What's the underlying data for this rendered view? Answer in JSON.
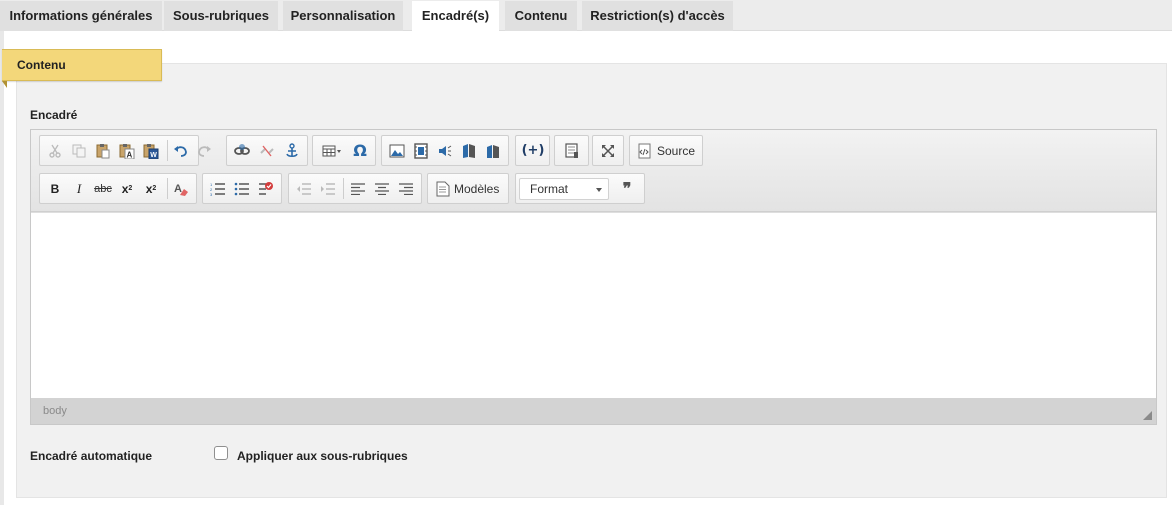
{
  "tabs": [
    {
      "label": "Informations générales",
      "active": false
    },
    {
      "label": "Sous-rubriques",
      "active": false
    },
    {
      "label": "Personnalisation",
      "active": false
    },
    {
      "label": "Encadré(s)",
      "active": true
    },
    {
      "label": "Contenu",
      "active": false
    },
    {
      "label": "Restriction(s) d'accès",
      "active": false
    }
  ],
  "section": {
    "label": "Contenu"
  },
  "editor": {
    "label": "Encadré",
    "toolbar": {
      "source_label": "Source",
      "templates_label": "Modèles",
      "format_value": "Format",
      "quote_glyph": "❞"
    },
    "body_content": "",
    "statusbar_path": "body"
  },
  "auto_box": {
    "label": "Encadré automatique",
    "checkbox_label": "Appliquer aux sous-rubriques",
    "checked": false
  },
  "colors": {
    "section_tab": "#f3d77a",
    "toolbar_icon": "#2c6aa8"
  }
}
